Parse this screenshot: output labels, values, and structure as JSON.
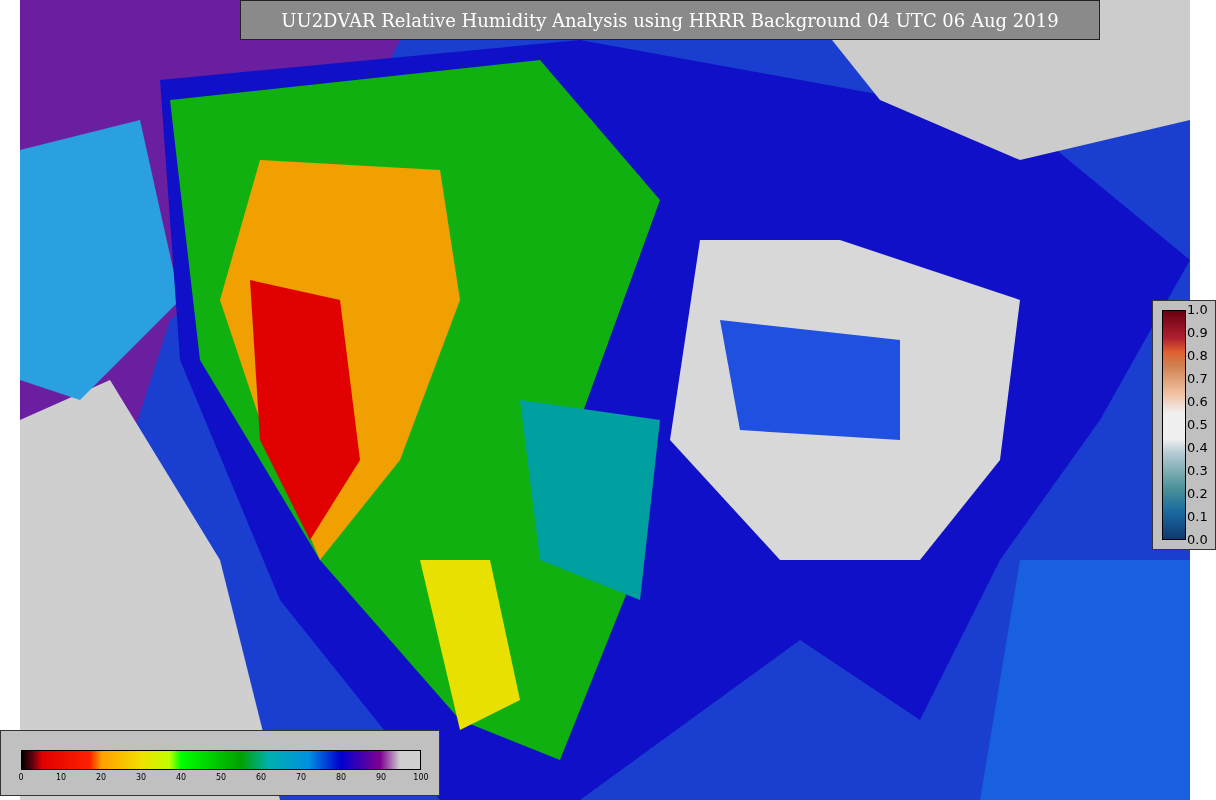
{
  "title": "UU2DVAR Relative Humidity Analysis using HRRR Background 04 UTC 06 Aug 2019",
  "humidity_colorbar": {
    "ticks": [
      "0",
      "10",
      "20",
      "30",
      "40",
      "50",
      "60",
      "70",
      "80",
      "90",
      "100"
    ]
  },
  "ratio_colorbar": {
    "ticks": [
      "1.0",
      "0.9",
      "0.8",
      "0.7",
      "0.6",
      "0.5",
      "0.4",
      "0.3",
      "0.2",
      "0.1",
      "0.0"
    ]
  }
}
